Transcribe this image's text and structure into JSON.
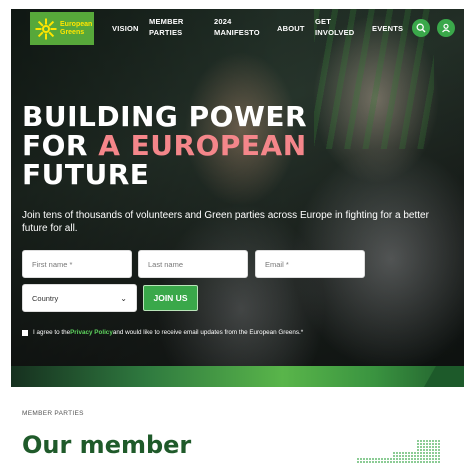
{
  "header": {
    "logo_line1": "European",
    "logo_line2": "Greens",
    "nav": [
      {
        "label": "VISION"
      },
      {
        "label": "MEMBER\nPARTIES"
      },
      {
        "label": "2024\nMANIFESTO"
      },
      {
        "label": "ABOUT"
      },
      {
        "label": "GET\nINVOLVED"
      },
      {
        "label": "EVENTS"
      }
    ],
    "search_icon": "search-icon",
    "account_icon": "user-icon",
    "accent_color": "#3aa84a"
  },
  "hero": {
    "headline_line1": "BUILDING POWER",
    "headline_for": "FOR ",
    "headline_accent": "A EUROPEAN",
    "headline_line3": "FUTURE",
    "lead": "Join tens of thousands of volunteers and Green parties across Europe in fighting for a better future for all.",
    "accent_color": "#f4868a"
  },
  "form": {
    "first_name_placeholder": "First name *",
    "last_name_placeholder": "Last name",
    "email_placeholder": "Email *",
    "country_value": "Country",
    "join_label": "JOIN US",
    "consent_before": "I agree to the ",
    "consent_link": "Privacy Policy",
    "consent_after": " and would like to receive email updates from the European Greens.*"
  },
  "members": {
    "kicker": "MEMBER PARTIES",
    "title": "Our member"
  }
}
